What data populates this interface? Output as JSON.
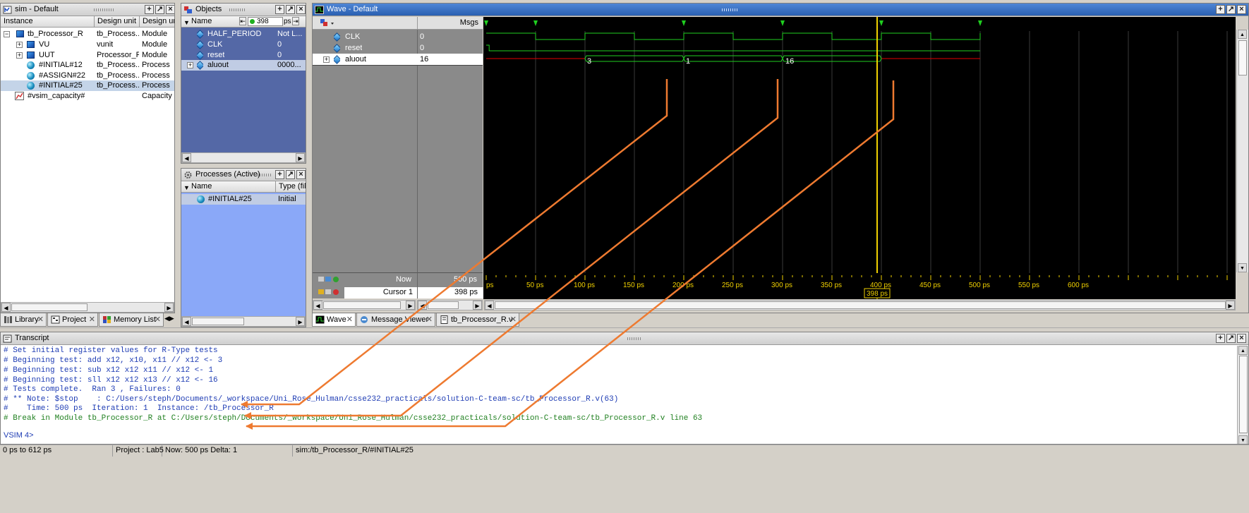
{
  "colors": {
    "wave_green": "#1fcf1f",
    "wave_red": "#e00000",
    "cursor": "#f0d000",
    "arrow": "#ee7a30",
    "transcript_blue": "#1e3cb4",
    "transcript_green": "#208020"
  },
  "sim": {
    "title": "sim - Default",
    "columns": [
      "Instance",
      "Design unit",
      "Design unit"
    ],
    "rows": [
      {
        "name": "tb_Processor_R",
        "unit": "tb_Process...",
        "type": "Module",
        "icon": "module-icon"
      },
      {
        "name": "VU",
        "unit": "vunit",
        "type": "Module",
        "icon": "module-icon"
      },
      {
        "name": "UUT",
        "unit": "Processor_R",
        "type": "Module",
        "icon": "module-icon"
      },
      {
        "name": "#INITIAL#12",
        "unit": "tb_Process...",
        "type": "Process",
        "icon": "process-icon"
      },
      {
        "name": "#ASSIGN#22",
        "unit": "tb_Process...",
        "type": "Process",
        "icon": "process-icon"
      },
      {
        "name": "#INITIAL#25",
        "unit": "tb_Process...",
        "type": "Process",
        "icon": "process-icon"
      },
      {
        "name": "#vsim_capacity#",
        "unit": "",
        "type": "Capacity",
        "icon": "capacity-icon"
      }
    ],
    "tabs": [
      "Library",
      "Project",
      "Memory List"
    ]
  },
  "objects": {
    "title": "Objects",
    "time_value": "398",
    "time_unit": "ps",
    "columns": [
      "Name"
    ],
    "rows": [
      {
        "name": "HALF_PERIOD",
        "value": "Not L..."
      },
      {
        "name": "CLK",
        "value": "0"
      },
      {
        "name": "reset",
        "value": "0"
      },
      {
        "name": "aluout",
        "value": "0000..."
      }
    ]
  },
  "processes": {
    "title": "Processes (Active)",
    "columns": [
      "Name",
      "Type (filt"
    ],
    "rows": [
      {
        "name": "#INITIAL#25",
        "type": "Initial"
      }
    ]
  },
  "wave": {
    "title": "Wave - Default",
    "msgs_label": "Msgs",
    "signals": [
      {
        "name": "CLK",
        "value": "0"
      },
      {
        "name": "reset",
        "value": "0"
      },
      {
        "name": "aluout",
        "value": "16"
      }
    ],
    "bus_values": [
      "3",
      "1",
      "16"
    ],
    "now_label": "Now",
    "now_value": "500 ps",
    "cursor_label": "Cursor 1",
    "cursor_value": "398 ps",
    "cursor_marker": "398 ps",
    "ticks": [
      "ps",
      "50 ps",
      "100 ps",
      "150 ps",
      "200 ps",
      "250 ps",
      "300 ps",
      "350 ps",
      "400 ps",
      "450 ps",
      "500 ps",
      "550 ps",
      "600 ps"
    ],
    "tabs": [
      "Wave",
      "Message Viewer",
      "tb_Processor_R.v"
    ]
  },
  "transcript": {
    "title": "Transcript",
    "lines": [
      {
        "text": "# Set initial register values for R-Type tests",
        "color": "blue"
      },
      {
        "text": "# Beginning test: add x12, x10, x11 // x12 <- 3",
        "color": "blue"
      },
      {
        "text": "# Beginning test: sub x12 x12 x11 // x12 <- 1",
        "color": "blue"
      },
      {
        "text": "# Beginning test: sll x12 x12 x13 // x12 <- 16",
        "color": "blue"
      },
      {
        "text": "# Tests complete.  Ran 3 , Failures: 0",
        "color": "blue"
      },
      {
        "text": "# ** Note: $stop    : C:/Users/steph/Documents/_workspace/Uni_Rose_Hulman/csse232_practicals/solution-C-team-sc/tb_Processor_R.v(63)",
        "color": "blue"
      },
      {
        "text": "#    Time: 500 ps  Iteration: 1  Instance: /tb_Processor_R",
        "color": "blue"
      },
      {
        "text": "# Break in Module tb_Processor_R at C:/Users/steph/Documents/_workspace/Uni_Rose_Hulman/csse232_practicals/solution-C-team-sc/tb_Processor_R.v line 63",
        "color": "green"
      }
    ],
    "prompt": "VSIM 4>"
  },
  "status": {
    "range": "0 ps to 612 ps",
    "project": "Project : Lab5",
    "now": "Now: 500 ps  Delta: 1",
    "path": "sim:/tb_Processor_R/#INITIAL#25"
  }
}
